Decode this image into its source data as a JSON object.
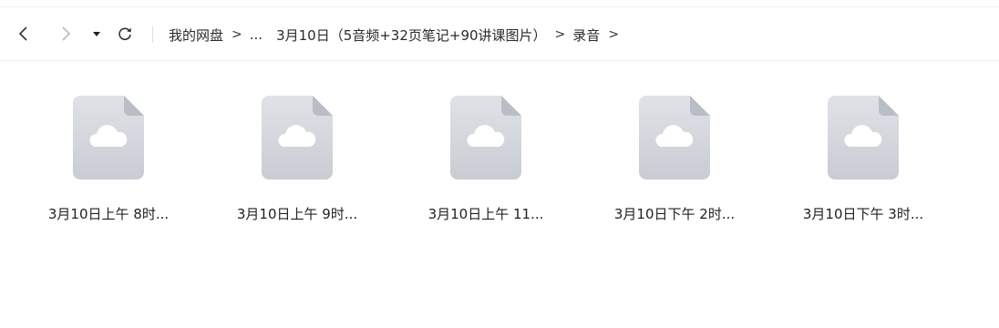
{
  "nav": {
    "back_icon": "chevron-left-icon",
    "forward_icon": "chevron-right-icon",
    "history_icon": "caret-down-icon",
    "refresh_icon": "refresh-icon"
  },
  "breadcrumb": {
    "root": "我的网盘",
    "separator": ">",
    "ellipsis": "...",
    "folder": "3月10日（5音频+32页笔记+90讲课图片）",
    "current": "录音"
  },
  "files": [
    {
      "name": "3月10日上午 8时...",
      "icon": "cloud-file-icon"
    },
    {
      "name": "3月10日上午 9时...",
      "icon": "cloud-file-icon"
    },
    {
      "name": "3月10日上午 11...",
      "icon": "cloud-file-icon"
    },
    {
      "name": "3月10日下午 2时...",
      "icon": "cloud-file-icon"
    },
    {
      "name": "3月10日下午 3时...",
      "icon": "cloud-file-icon"
    }
  ],
  "colors": {
    "icon_top": "#dfe2e7",
    "icon_bottom": "#c9ccd3",
    "icon_fold": "#b9bdc5"
  }
}
